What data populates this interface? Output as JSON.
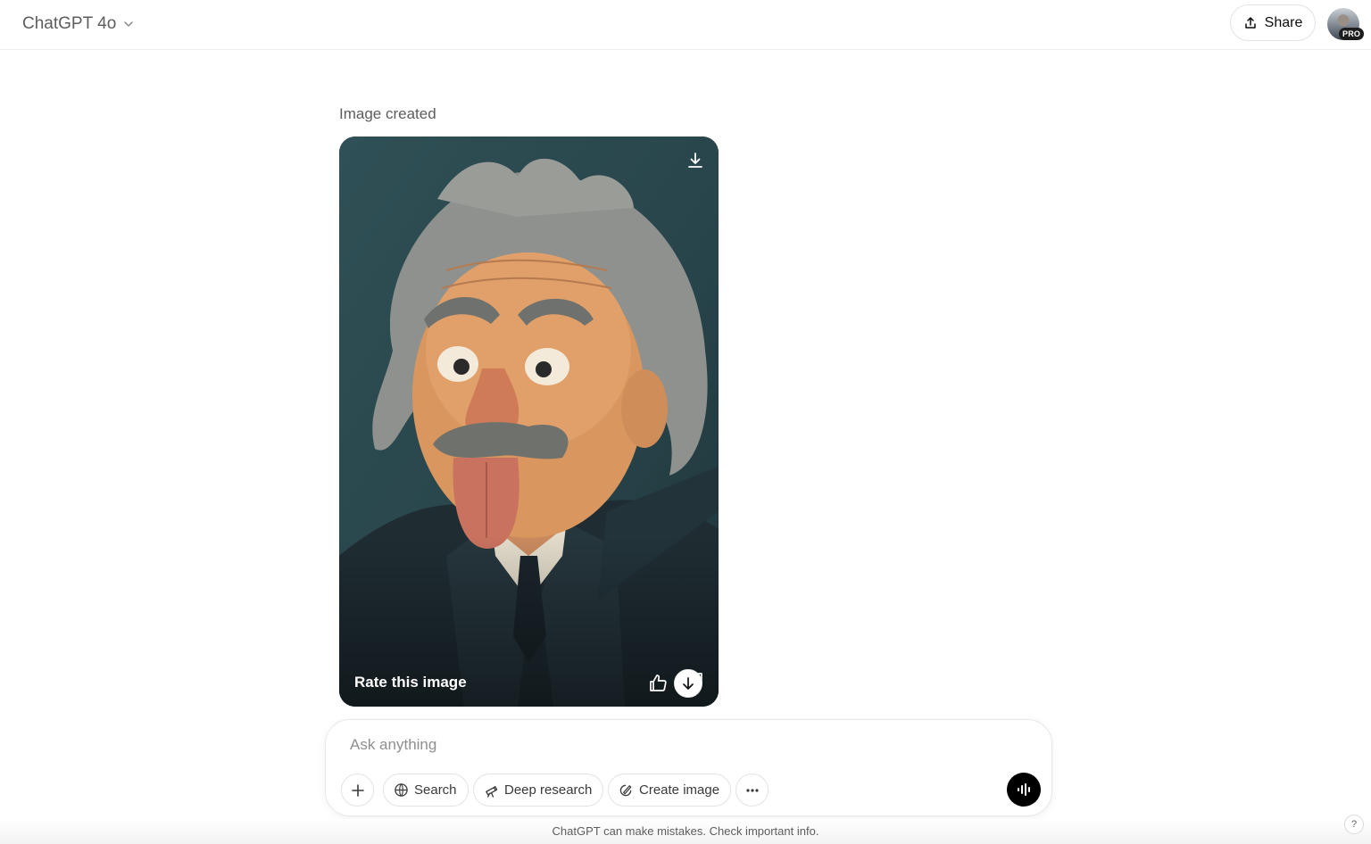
{
  "header": {
    "model_name": "ChatGPT 4o",
    "share_label": "Share",
    "avatar_badge": "PRO"
  },
  "message": {
    "status": "Image created",
    "rate_label": "Rate this image"
  },
  "composer": {
    "placeholder": "Ask anything",
    "tools": {
      "search": "Search",
      "deep_research": "Deep research",
      "create_image": "Create image"
    }
  },
  "footer": {
    "disclaimer": "ChatGPT can make mistakes. Check important info.",
    "help": "?"
  },
  "colors": {
    "image_background": "#2b4a50",
    "voice_button": "#000000"
  },
  "icons": [
    "chevron-down-icon",
    "share-icon",
    "download-icon",
    "thumbs-up-icon",
    "thumbs-down-icon",
    "arrow-down-icon",
    "plus-icon",
    "globe-icon",
    "telescope-icon",
    "image-brush-icon",
    "more-icon",
    "voice-waveform-icon"
  ]
}
